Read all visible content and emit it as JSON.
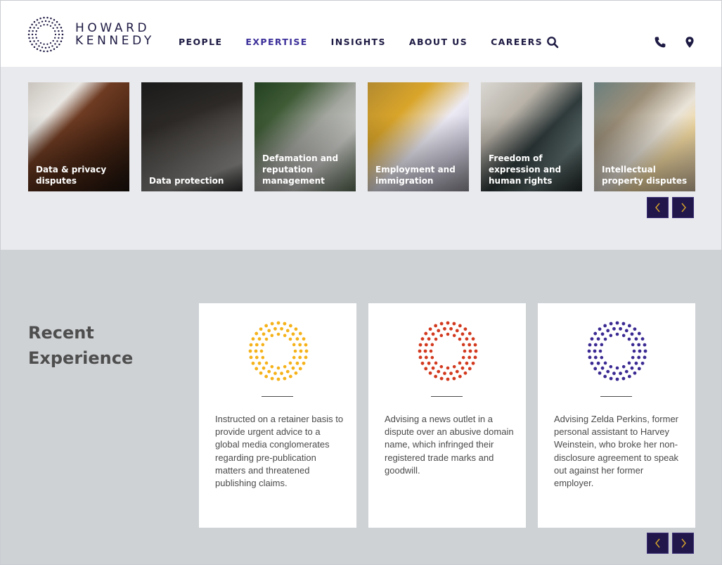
{
  "brand": {
    "line1": "HOWARD",
    "line2": "KENNEDY",
    "logo_icon": "dotted-ring-logo"
  },
  "nav": {
    "items": [
      {
        "label": "PEOPLE",
        "active": false
      },
      {
        "label": "EXPERTISE",
        "active": true
      },
      {
        "label": "INSIGHTS",
        "active": false
      },
      {
        "label": "ABOUT US",
        "active": false
      },
      {
        "label": "CAREERS",
        "active": false
      }
    ],
    "icons": [
      "search-icon",
      "phone-icon",
      "location-pin-icon"
    ]
  },
  "expertise_tiles": [
    {
      "label": "Data & privacy disputes"
    },
    {
      "label": "Data protection"
    },
    {
      "label": "Defamation and reputation management"
    },
    {
      "label": "Employment and immigration"
    },
    {
      "label": "Freedom of expression and human rights"
    },
    {
      "label": "Intellectual property disputes"
    }
  ],
  "recent_experience": {
    "title": "Recent Experience",
    "cards": [
      {
        "color": "#f5b21a",
        "text": "Instructed on a retainer basis to provide urgent advice to a global media conglomerates regarding pre-publication matters and threatened publishing claims."
      },
      {
        "color": "#d23a1f",
        "text": "Advising a news outlet in a dispute over an abusive domain name, which infringed their registered trade marks and goodwill."
      },
      {
        "color": "#3b2a92",
        "text": "Advising Zelda Perkins, former personal assistant to Harvey Weinstein, who broke her non-disclosure agreement to speak out against her former employer."
      }
    ]
  },
  "colors": {
    "navy": "#1d1a43",
    "accent": "#3b2f99",
    "arrow_bg": "#22174a",
    "arrow_chevron": "#d8a72b"
  }
}
